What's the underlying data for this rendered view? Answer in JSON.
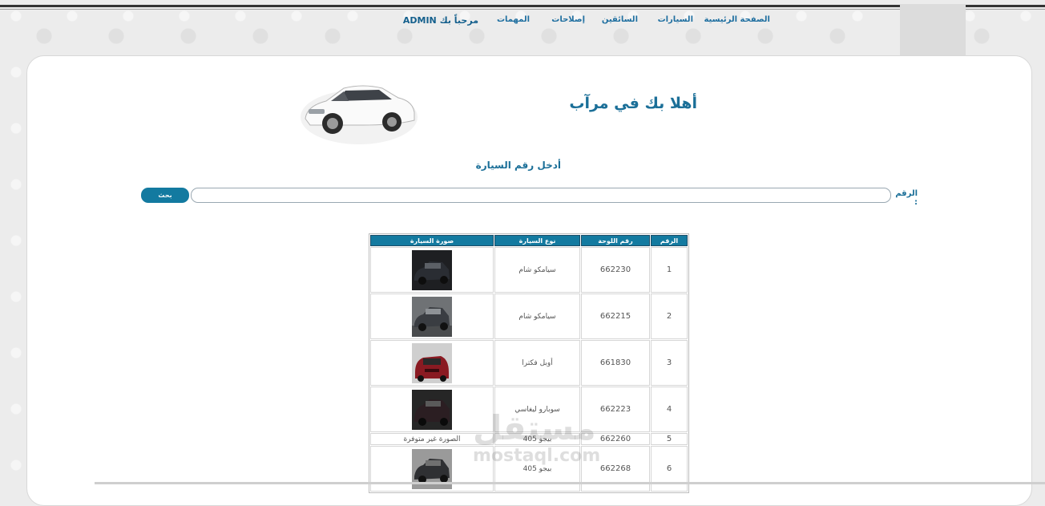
{
  "nav": {
    "items": [
      {
        "label": "الصفحة الرئيسية"
      },
      {
        "label": "السيارات"
      },
      {
        "label": "السائقين"
      },
      {
        "label": "إصلاحات"
      },
      {
        "label": "المهمات"
      },
      {
        "label": "مرحباً بك ADMIN"
      }
    ]
  },
  "hero": {
    "title": "أهلا بك في مرآب"
  },
  "search": {
    "prompt": "أدخل رقم السيارة",
    "label": "الرقم :",
    "value": "",
    "button_label": "بحث"
  },
  "table": {
    "headers": [
      "الرقم",
      "رقم اللوحة",
      "نوع السيارة",
      "صورة السيارة"
    ],
    "rows": [
      {
        "num": "1",
        "plate": "662230",
        "type": "سيامكو شام",
        "image": "photo",
        "photo_color": "#2a2d33"
      },
      {
        "num": "2",
        "plate": "662215",
        "type": "سيامكو شام",
        "image": "photo",
        "photo_color": "#3a3d42"
      },
      {
        "num": "3",
        "plate": "661830",
        "type": "أوبل فكترا",
        "image": "photo",
        "photo_color": "#8a1a22"
      },
      {
        "num": "4",
        "plate": "662223",
        "type": "سوبارو ليغاسي",
        "image": "photo",
        "photo_color": "#2b1e22"
      },
      {
        "num": "5",
        "plate": "662260",
        "type": "بيجو 405",
        "image": "الصورة غير متوفرة",
        "photo_color": ""
      },
      {
        "num": "6",
        "plate": "662268",
        "type": "بيجو 405",
        "image": "photo",
        "photo_color": "#2f3033"
      }
    ]
  },
  "watermark": {
    "arabic": "مستقل",
    "latin": "mostaql.com"
  },
  "colors": {
    "accent": "#137aa0",
    "heading": "#1b6f98",
    "panel": "#ffffff",
    "background": "#ececec"
  }
}
